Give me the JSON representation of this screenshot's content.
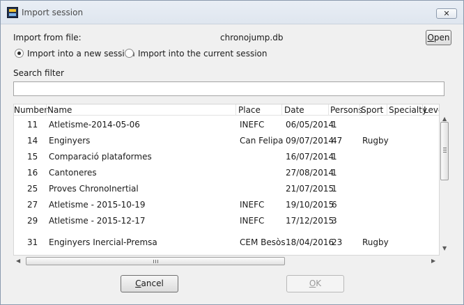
{
  "window": {
    "title": "Import session",
    "close_label": "✕"
  },
  "import": {
    "from_file_label": "Import from file:",
    "file_name": "chronojump.db",
    "open_label": "Open",
    "open_mnemonic": "O",
    "open_rest": "pen"
  },
  "radios": {
    "new_session": {
      "label": "Import into a new session",
      "checked": true
    },
    "current_session": {
      "label": "Import into the current session",
      "checked": false
    }
  },
  "search": {
    "label": "Search filter",
    "value": ""
  },
  "table": {
    "columns": [
      "Number",
      "Name",
      "Place",
      "Date",
      "Persons",
      "Sport",
      "Specialty",
      "Leve"
    ],
    "rows": [
      {
        "number": "11",
        "name": "Atletisme-2014-05-06",
        "place": "INEFC",
        "date": "06/05/2014",
        "persons": "1",
        "sport": ""
      },
      {
        "number": "14",
        "name": "Enginyers",
        "place": "Can Felipa",
        "date": "09/07/2014",
        "persons": "47",
        "sport": "Rugby"
      },
      {
        "number": "15",
        "name": "Comparació plataformes",
        "place": "",
        "date": "16/07/2014",
        "persons": "1",
        "sport": ""
      },
      {
        "number": "16",
        "name": "Cantoneres",
        "place": "",
        "date": "27/08/2014",
        "persons": "1",
        "sport": ""
      },
      {
        "number": "25",
        "name": "Proves ChronoInertial",
        "place": "",
        "date": "21/07/2015",
        "persons": "1",
        "sport": ""
      },
      {
        "number": "27",
        "name": "Atletisme - 2015-10-19",
        "place": "INEFC",
        "date": "19/10/2015",
        "persons": "6",
        "sport": ""
      },
      {
        "number": "29",
        "name": "Atletisme - 2015-12-17",
        "place": "INEFC",
        "date": "17/12/2015",
        "persons": "3",
        "sport": ""
      },
      {
        "number": "31",
        "name": "Enginyers Inercial-Premsa",
        "place": "CEM Besòs",
        "date": "18/04/2016",
        "persons": "23",
        "sport": "Rugby"
      }
    ]
  },
  "buttons": {
    "cancel_mnemonic": "C",
    "cancel_rest": "ancel",
    "ok_mnemonic": "O",
    "ok_rest": "K"
  }
}
